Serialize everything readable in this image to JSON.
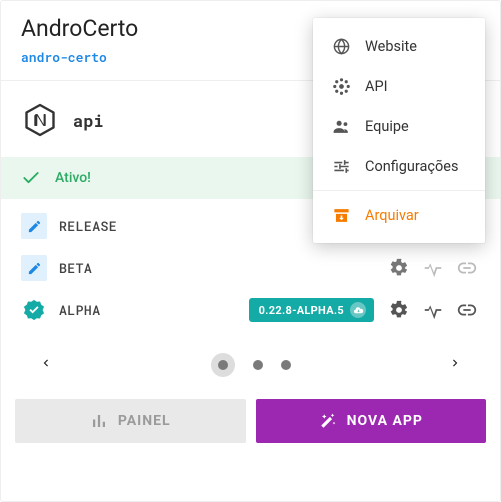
{
  "header": {
    "title": "AndroCerto",
    "slug": "andro-certo"
  },
  "app": {
    "name": "api",
    "runtime_icon": "nodejs"
  },
  "status": {
    "label": "Ativo!",
    "ok": true
  },
  "environments": [
    {
      "kind": "edit",
      "name": "RELEASE",
      "version": null,
      "actions": {
        "settings": true,
        "health": false,
        "link": false
      }
    },
    {
      "kind": "edit",
      "name": "BETA",
      "version": null,
      "actions": {
        "settings": true,
        "health": false,
        "link": false
      }
    },
    {
      "kind": "verified",
      "name": "ALPHA",
      "version": "0.22.8-ALPHA.5",
      "actions": {
        "settings": true,
        "health": true,
        "link": true
      }
    }
  ],
  "pager": {
    "count": 3,
    "active": 0
  },
  "footer": {
    "panel_label": "PAINEL",
    "new_app_label": "NOVA APP"
  },
  "menu": {
    "items": [
      {
        "icon": "globe",
        "label": "Website"
      },
      {
        "icon": "api",
        "label": "API"
      },
      {
        "icon": "team",
        "label": "Equipe"
      },
      {
        "icon": "settings",
        "label": "Configurações"
      }
    ],
    "danger": {
      "icon": "archive",
      "label": "Arquivar"
    }
  },
  "colors": {
    "primary": "#9c27b0",
    "accent_teal": "#14aaa5",
    "link_blue": "#1e88e5",
    "success": "#27ae60",
    "warning": "#f57c00"
  }
}
